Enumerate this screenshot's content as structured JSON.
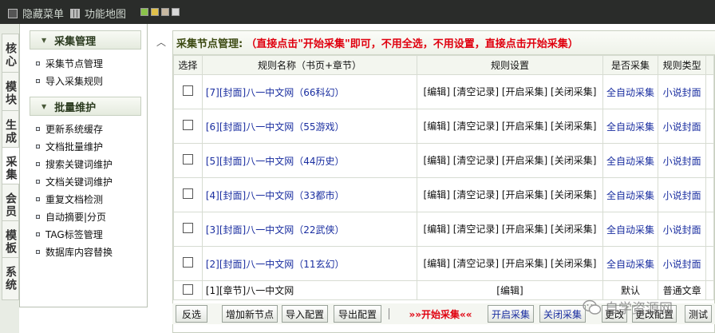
{
  "topbar": {
    "hide_menu": "隐藏菜单",
    "site_map": "功能地图",
    "swatch_colors": [
      "#8bc34a",
      "#e0c14a",
      "#c7b8a0",
      "#d8d8d8"
    ]
  },
  "left_tabs": [
    "核心",
    "模块",
    "生成",
    "采集",
    "会员",
    "模板",
    "系统"
  ],
  "menu": {
    "group1": "采集管理",
    "group1_items": [
      "采集节点管理",
      "导入采集规则"
    ],
    "group2": "批量维护",
    "group2_items": [
      "更新系统缓存",
      "文档批量维护",
      "搜索关键词维护",
      "文档关键词维护",
      "重复文档检测",
      "自动摘要|分页",
      "TAG标签管理",
      "数据库内容替换"
    ]
  },
  "panel": {
    "title_label": "采集节点管理:",
    "title_hint": "（直接点击\"开始采集\"即可，不用全选，不用设置，直接点击开始采集）"
  },
  "table": {
    "headers": [
      "选择",
      "规则名称（书页+章节）",
      "规则设置",
      "是否采集",
      "规则类型"
    ],
    "rows": [
      {
        "name": "[7][封面]八一中文网（66科幻）",
        "settings": "[编辑] [清空记录] [开启采集] [关闭采集]",
        "auto": "全自动采集",
        "type": "小说封面"
      },
      {
        "name": "[6][封面]八一中文网（55游戏）",
        "settings": "[编辑] [清空记录] [开启采集] [关闭采集]",
        "auto": "全自动采集",
        "type": "小说封面"
      },
      {
        "name": "[5][封面]八一中文网（44历史）",
        "settings": "[编辑] [清空记录] [开启采集] [关闭采集]",
        "auto": "全自动采集",
        "type": "小说封面"
      },
      {
        "name": "[4][封面]八一中文网（33都市）",
        "settings": "[编辑] [清空记录] [开启采集] [关闭采集]",
        "auto": "全自动采集",
        "type": "小说封面"
      },
      {
        "name": "[3][封面]八一中文网（22武侠）",
        "settings": "[编辑] [清空记录] [开启采集] [关闭采集]",
        "auto": "全自动采集",
        "type": "小说封面"
      },
      {
        "name": "[2][封面]八一中文网（11玄幻）",
        "settings": "[编辑] [清空记录] [开启采集] [关闭采集]",
        "auto": "全自动采集",
        "type": "小说封面"
      },
      {
        "name": "[1][章节]八一中文网",
        "settings": "[编辑]",
        "auto": "默认",
        "type": "普通文章"
      }
    ]
  },
  "toolbar": {
    "invert": "反选",
    "add_node": "增加新节点",
    "import": "导入配置",
    "export": "导出配置",
    "start": "»»开始采集««",
    "enable": "开启采集",
    "disable": "关闭采集",
    "edit": "更改",
    "edit_config": "更改配置",
    "test": "测试"
  },
  "watermark": "自学资源网"
}
